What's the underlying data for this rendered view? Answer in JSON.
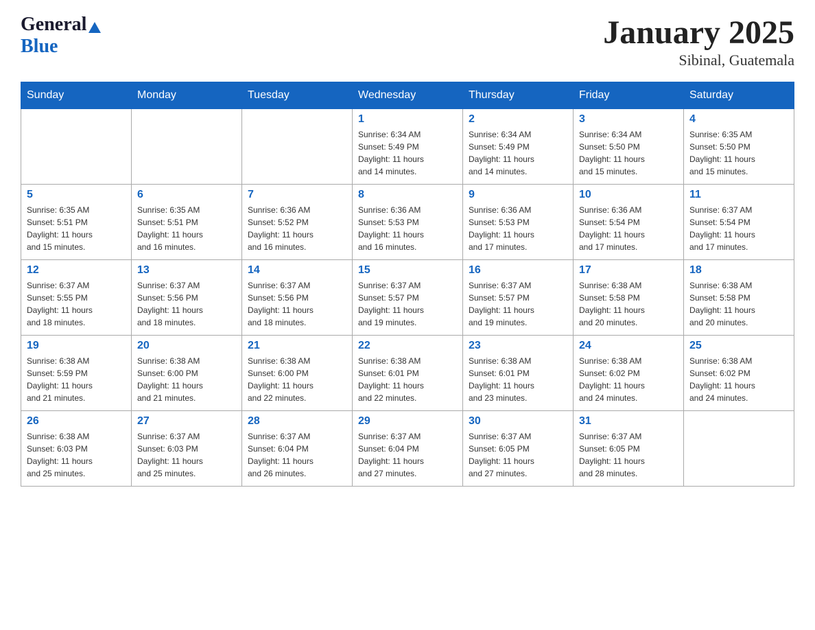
{
  "logo": {
    "general": "General",
    "blue": "Blue"
  },
  "title": "January 2025",
  "subtitle": "Sibinal, Guatemala",
  "weekdays": [
    "Sunday",
    "Monday",
    "Tuesday",
    "Wednesday",
    "Thursday",
    "Friday",
    "Saturday"
  ],
  "weeks": [
    [
      {
        "day": "",
        "info": ""
      },
      {
        "day": "",
        "info": ""
      },
      {
        "day": "",
        "info": ""
      },
      {
        "day": "1",
        "info": "Sunrise: 6:34 AM\nSunset: 5:49 PM\nDaylight: 11 hours\nand 14 minutes."
      },
      {
        "day": "2",
        "info": "Sunrise: 6:34 AM\nSunset: 5:49 PM\nDaylight: 11 hours\nand 14 minutes."
      },
      {
        "day": "3",
        "info": "Sunrise: 6:34 AM\nSunset: 5:50 PM\nDaylight: 11 hours\nand 15 minutes."
      },
      {
        "day": "4",
        "info": "Sunrise: 6:35 AM\nSunset: 5:50 PM\nDaylight: 11 hours\nand 15 minutes."
      }
    ],
    [
      {
        "day": "5",
        "info": "Sunrise: 6:35 AM\nSunset: 5:51 PM\nDaylight: 11 hours\nand 15 minutes."
      },
      {
        "day": "6",
        "info": "Sunrise: 6:35 AM\nSunset: 5:51 PM\nDaylight: 11 hours\nand 16 minutes."
      },
      {
        "day": "7",
        "info": "Sunrise: 6:36 AM\nSunset: 5:52 PM\nDaylight: 11 hours\nand 16 minutes."
      },
      {
        "day": "8",
        "info": "Sunrise: 6:36 AM\nSunset: 5:53 PM\nDaylight: 11 hours\nand 16 minutes."
      },
      {
        "day": "9",
        "info": "Sunrise: 6:36 AM\nSunset: 5:53 PM\nDaylight: 11 hours\nand 17 minutes."
      },
      {
        "day": "10",
        "info": "Sunrise: 6:36 AM\nSunset: 5:54 PM\nDaylight: 11 hours\nand 17 minutes."
      },
      {
        "day": "11",
        "info": "Sunrise: 6:37 AM\nSunset: 5:54 PM\nDaylight: 11 hours\nand 17 minutes."
      }
    ],
    [
      {
        "day": "12",
        "info": "Sunrise: 6:37 AM\nSunset: 5:55 PM\nDaylight: 11 hours\nand 18 minutes."
      },
      {
        "day": "13",
        "info": "Sunrise: 6:37 AM\nSunset: 5:56 PM\nDaylight: 11 hours\nand 18 minutes."
      },
      {
        "day": "14",
        "info": "Sunrise: 6:37 AM\nSunset: 5:56 PM\nDaylight: 11 hours\nand 18 minutes."
      },
      {
        "day": "15",
        "info": "Sunrise: 6:37 AM\nSunset: 5:57 PM\nDaylight: 11 hours\nand 19 minutes."
      },
      {
        "day": "16",
        "info": "Sunrise: 6:37 AM\nSunset: 5:57 PM\nDaylight: 11 hours\nand 19 minutes."
      },
      {
        "day": "17",
        "info": "Sunrise: 6:38 AM\nSunset: 5:58 PM\nDaylight: 11 hours\nand 20 minutes."
      },
      {
        "day": "18",
        "info": "Sunrise: 6:38 AM\nSunset: 5:58 PM\nDaylight: 11 hours\nand 20 minutes."
      }
    ],
    [
      {
        "day": "19",
        "info": "Sunrise: 6:38 AM\nSunset: 5:59 PM\nDaylight: 11 hours\nand 21 minutes."
      },
      {
        "day": "20",
        "info": "Sunrise: 6:38 AM\nSunset: 6:00 PM\nDaylight: 11 hours\nand 21 minutes."
      },
      {
        "day": "21",
        "info": "Sunrise: 6:38 AM\nSunset: 6:00 PM\nDaylight: 11 hours\nand 22 minutes."
      },
      {
        "day": "22",
        "info": "Sunrise: 6:38 AM\nSunset: 6:01 PM\nDaylight: 11 hours\nand 22 minutes."
      },
      {
        "day": "23",
        "info": "Sunrise: 6:38 AM\nSunset: 6:01 PM\nDaylight: 11 hours\nand 23 minutes."
      },
      {
        "day": "24",
        "info": "Sunrise: 6:38 AM\nSunset: 6:02 PM\nDaylight: 11 hours\nand 24 minutes."
      },
      {
        "day": "25",
        "info": "Sunrise: 6:38 AM\nSunset: 6:02 PM\nDaylight: 11 hours\nand 24 minutes."
      }
    ],
    [
      {
        "day": "26",
        "info": "Sunrise: 6:38 AM\nSunset: 6:03 PM\nDaylight: 11 hours\nand 25 minutes."
      },
      {
        "day": "27",
        "info": "Sunrise: 6:37 AM\nSunset: 6:03 PM\nDaylight: 11 hours\nand 25 minutes."
      },
      {
        "day": "28",
        "info": "Sunrise: 6:37 AM\nSunset: 6:04 PM\nDaylight: 11 hours\nand 26 minutes."
      },
      {
        "day": "29",
        "info": "Sunrise: 6:37 AM\nSunset: 6:04 PM\nDaylight: 11 hours\nand 27 minutes."
      },
      {
        "day": "30",
        "info": "Sunrise: 6:37 AM\nSunset: 6:05 PM\nDaylight: 11 hours\nand 27 minutes."
      },
      {
        "day": "31",
        "info": "Sunrise: 6:37 AM\nSunset: 6:05 PM\nDaylight: 11 hours\nand 28 minutes."
      },
      {
        "day": "",
        "info": ""
      }
    ]
  ]
}
